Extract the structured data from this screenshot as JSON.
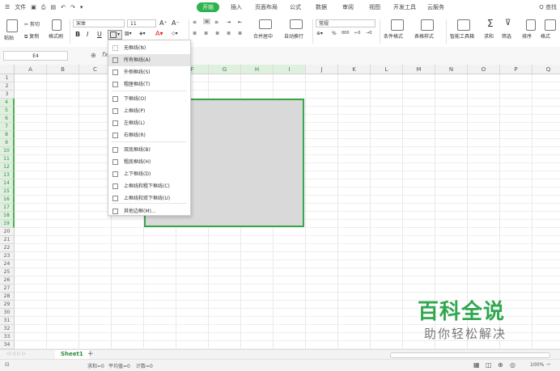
{
  "menubar": {
    "file": "文件",
    "tabs": [
      "开始",
      "插入",
      "页面布局",
      "公式",
      "数据",
      "审阅",
      "视图",
      "开发工具",
      "云服务"
    ],
    "active_tab": "开始",
    "search": "Q 查找"
  },
  "ribbon": {
    "paste": "粘贴",
    "cut": "剪切",
    "copy": "复制",
    "format_painter": "格式刷",
    "font_name": "宋体",
    "font_size": "11",
    "bold": "B",
    "italic": "I",
    "underline": "U",
    "merge_center": "合并居中",
    "wrap_text": "自动换行",
    "number_format": "常规",
    "percent": "%",
    "thousands": "000",
    "cond_format": "条件格式",
    "table_style": "表格样式",
    "smart_tools": "智能工具箱",
    "sum": "求和",
    "filter": "筛选",
    "sort": "排序",
    "format": "格式"
  },
  "formula": {
    "cell": "E4",
    "fx": "fx"
  },
  "columns": [
    "A",
    "B",
    "C",
    "D",
    "E",
    "F",
    "G",
    "H",
    "I",
    "J",
    "K",
    "L",
    "M",
    "N",
    "O",
    "P",
    "Q"
  ],
  "rows": [
    "1",
    "2",
    "3",
    "4",
    "5",
    "6",
    "7",
    "8",
    "9",
    "10",
    "11",
    "12",
    "13",
    "14",
    "15",
    "16",
    "17",
    "18",
    "19",
    "20",
    "21",
    "22",
    "23",
    "24",
    "25",
    "26",
    "27",
    "28",
    "29",
    "30",
    "31",
    "32",
    "33",
    "34"
  ],
  "dropdown": {
    "items": [
      {
        "label": "无框线(N)"
      },
      {
        "label": "所有框线(A)"
      },
      {
        "label": "外侧框线(S)"
      },
      {
        "label": "粗匣框线(T)"
      },
      {
        "label": "下框线(O)"
      },
      {
        "label": "上框线(P)"
      },
      {
        "label": "左框线(L)"
      },
      {
        "label": "右框线(R)"
      },
      {
        "label": "双底框线(B)"
      },
      {
        "label": "粗底框线(H)"
      },
      {
        "label": "上下框线(D)"
      },
      {
        "label": "上框线和粗下框线(C)"
      },
      {
        "label": "上框线和双下框线(U)"
      },
      {
        "label": "其他边框(M)..."
      }
    ]
  },
  "sheet": {
    "name": "Sheet1",
    "add": "+"
  },
  "status": {
    "sum": "求和=0",
    "avg": "平均值=0",
    "count": "计数=0",
    "zoom": "100%"
  },
  "watermark": {
    "line1": "百科全说",
    "line2": "助你轻松解决"
  },
  "colors": {
    "accent": "#2db24c",
    "selection_border": "#3aa64a",
    "selection_fill": "#d9d9d9"
  }
}
